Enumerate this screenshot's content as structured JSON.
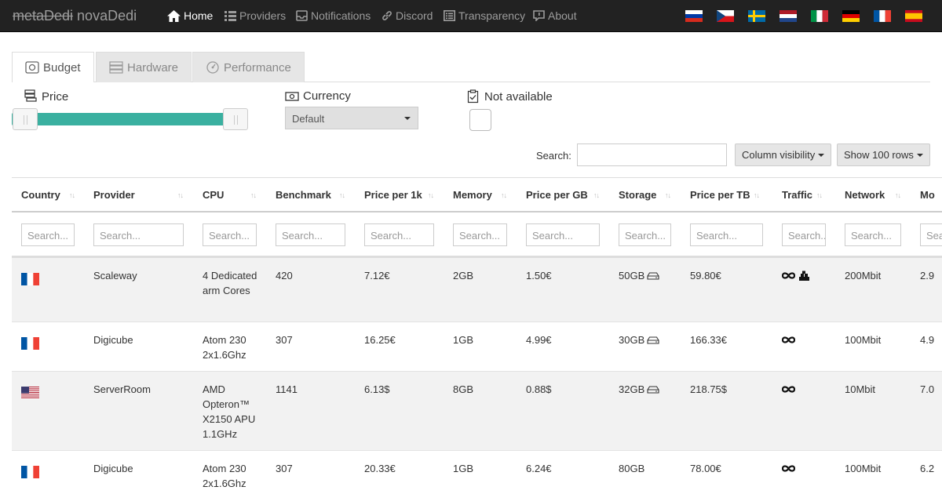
{
  "navbar": {
    "brand_strike": "metaDedi",
    "brand_name": "novaDedi",
    "items": [
      {
        "label": "Home",
        "icon": "home-icon"
      },
      {
        "label": "Providers",
        "icon": "list-icon"
      },
      {
        "label": "Notifications",
        "icon": "notification-icon"
      },
      {
        "label": "Discord",
        "icon": "link-icon"
      },
      {
        "label": "Transparency",
        "icon": "list-alt-icon"
      },
      {
        "label": "About",
        "icon": "comment-icon"
      }
    ],
    "languages": [
      "ru",
      "cz",
      "se",
      "nl",
      "it",
      "de",
      "fr",
      "es"
    ]
  },
  "tabs": [
    {
      "label": "Budget",
      "icon": "piggy-bank-icon"
    },
    {
      "label": "Hardware",
      "icon": "server-icon"
    },
    {
      "label": "Performance",
      "icon": "dashboard-icon"
    }
  ],
  "filters": {
    "price_label": "Price",
    "currency_label": "Currency",
    "currency_value": "Default",
    "not_available_label": "Not available"
  },
  "table_controls": {
    "search_label": "Search:",
    "column_visibility": "Column visibility",
    "show_rows": "Show 100 rows"
  },
  "columns": [
    "Country",
    "Provider",
    "CPU",
    "Benchmark",
    "Price per 1k",
    "Memory",
    "Price per GB",
    "Storage",
    "Price per TB",
    "Traffic",
    "Network",
    "Mo"
  ],
  "column_search_placeholder": "Search...",
  "rows": [
    {
      "country": "fr",
      "provider": "Scaleway",
      "cpu": "4 Dedicated arm Cores",
      "benchmark": "420",
      "price_per_1k": "7.12€",
      "memory": "2GB",
      "price_per_gb": "1.50€",
      "storage": "50GB",
      "price_per_tb": "59.80€",
      "traffic": "unlimited",
      "traffic_extra": "ddos-protection",
      "network": "200Mbit",
      "monthly": "2.9"
    },
    {
      "country": "fr",
      "provider": "Digicube",
      "cpu": "Atom 230 2x1.6Ghz",
      "benchmark": "307",
      "price_per_1k": "16.25€",
      "memory": "1GB",
      "price_per_gb": "4.99€",
      "storage": "30GB",
      "price_per_tb": "166.33€",
      "traffic": "unlimited",
      "network": "100Mbit",
      "monthly": "4.9"
    },
    {
      "country": "us",
      "provider": "ServerRoom",
      "cpu": "AMD Opteron™ X2150 APU 1.1GHz",
      "benchmark": "1141",
      "price_per_1k": "6.13$",
      "memory": "8GB",
      "price_per_gb": "0.88$",
      "storage": "32GB",
      "price_per_tb": "218.75$",
      "traffic": "unlimited",
      "network": "10Mbit",
      "monthly": "7.0"
    },
    {
      "country": "fr",
      "provider": "Digicube",
      "cpu": "Atom 230 2x1.6Ghz",
      "benchmark": "307",
      "price_per_1k": "20.33€",
      "memory": "1GB",
      "price_per_gb": "6.24€",
      "storage": "80GB",
      "price_per_tb": "78.00€",
      "traffic": "unlimited",
      "network": "100Mbit",
      "monthly": "6.2"
    }
  ]
}
